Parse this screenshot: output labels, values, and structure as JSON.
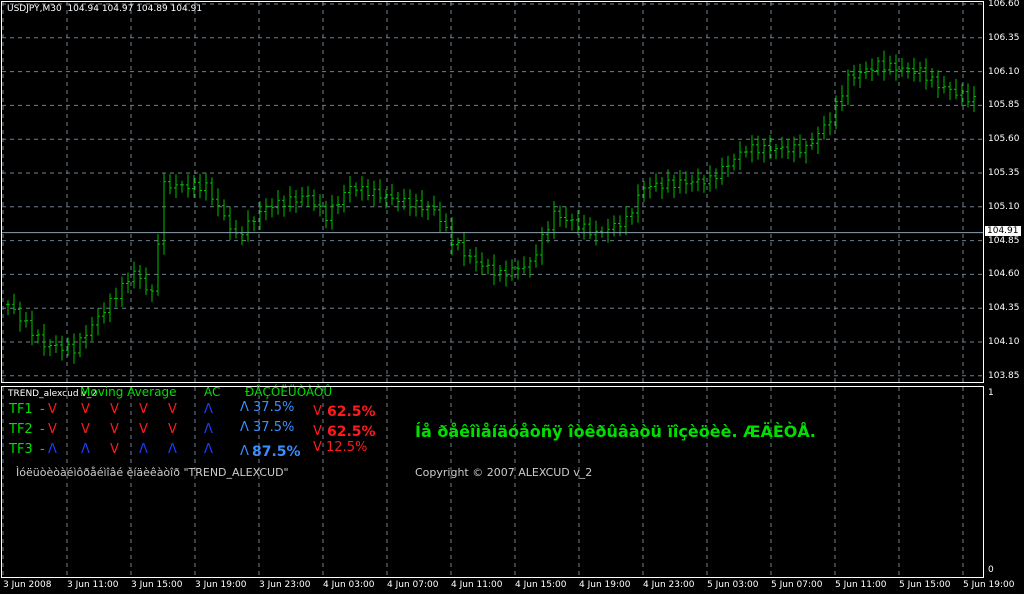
{
  "header": {
    "symbol": "USDJPY,M30",
    "open": "104.94",
    "high": "104.97",
    "low": "104.89",
    "close": "104.91"
  },
  "price_axis": {
    "labels": [
      "106.60",
      "106.35",
      "106.10",
      "105.85",
      "105.60",
      "105.35",
      "105.10",
      "104.85",
      "104.60",
      "104.35",
      "104.10",
      "103.85"
    ],
    "current": "104.91"
  },
  "time_axis": [
    "3 Jun 2008",
    "3 Jun 11:00",
    "3 Jun 15:00",
    "3 Jun 19:00",
    "3 Jun 23:00",
    "4 Jun 03:00",
    "4 Jun 07:00",
    "4 Jun 11:00",
    "4 Jun 15:00",
    "4 Jun 19:00",
    "4 Jun 23:00",
    "5 Jun 03:00",
    "5 Jun 07:00",
    "5 Jun 11:00",
    "5 Jun 15:00",
    "5 Jun 19:00"
  ],
  "chart_data": {
    "type": "ohlc",
    "price_range": [
      103.85,
      106.6
    ],
    "current_price": 104.91,
    "bar_count": 162,
    "close_waypoints": [
      [
        0,
        104.38
      ],
      [
        6,
        104.08
      ],
      [
        11,
        104.05
      ],
      [
        16,
        104.34
      ],
      [
        21,
        104.62
      ],
      [
        24,
        104.45
      ],
      [
        26,
        105.26
      ],
      [
        33,
        105.25
      ],
      [
        38,
        104.88
      ],
      [
        43,
        105.1
      ],
      [
        50,
        105.18
      ],
      [
        53,
        105.03
      ],
      [
        57,
        105.25
      ],
      [
        66,
        105.14
      ],
      [
        71,
        105.08
      ],
      [
        74,
        104.85
      ],
      [
        77,
        104.72
      ],
      [
        82,
        104.6
      ],
      [
        87,
        104.68
      ],
      [
        91,
        105.05
      ],
      [
        98,
        104.9
      ],
      [
        103,
        105.0
      ],
      [
        106,
        105.25
      ],
      [
        117,
        105.3
      ],
      [
        123,
        105.53
      ],
      [
        133,
        105.53
      ],
      [
        137,
        105.75
      ],
      [
        140,
        106.05
      ],
      [
        145,
        106.15
      ],
      [
        152,
        106.1
      ],
      [
        155,
        106.0
      ],
      [
        162,
        105.87
      ]
    ]
  },
  "indicator": {
    "name": "TREND_alexcud v_2",
    "headers": {
      "ma": "Moving Average",
      "ac": "AC",
      "result": "ÐÅÇÓËÜÒÀÒÛ"
    },
    "rows": [
      {
        "tf": "TF1",
        "dash": "-",
        "signals": [
          "V",
          "V",
          "V",
          "V",
          "V"
        ],
        "ac": "Λ",
        "up": "Λ 37.5%",
        "down_sym": "V",
        "down": "62.5%"
      },
      {
        "tf": "TF2",
        "dash": "-",
        "signals": [
          "V",
          "V",
          "V",
          "V",
          "V"
        ],
        "ac": "Λ",
        "up": "Λ 37.5%",
        "down_sym": "V",
        "down": "62.5%"
      },
      {
        "tf": "TF3",
        "dash": "-",
        "signals": [
          "Λ",
          "Λ",
          "V",
          "Λ",
          "Λ"
        ],
        "ac": "Λ",
        "up_sym": "Λ",
        "up": "87.5%",
        "down": "V 12.5%"
      }
    ],
    "caption": "Ìóëüòèòàéìôðåéìîâé èíäèêàòîð \"TREND_ALEXCUD\"",
    "message": "Íå ðåêîìåíäóåòñÿ îòêðûâàòü ïîçèöèè. ÆÄÈÒÅ.",
    "copyright": "Copyright © 2007 ALEXCUD v_2",
    "scale": [
      "1",
      "0"
    ]
  }
}
